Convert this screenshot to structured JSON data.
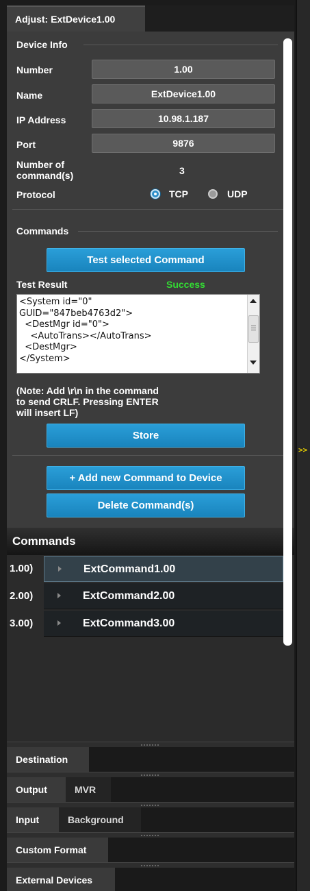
{
  "panel": {
    "title": "Adjust: ExtDevice1.00",
    "expand_arrow": ">>"
  },
  "device_info": {
    "heading": "Device Info",
    "number_label": "Number",
    "number_value": "1.00",
    "name_label": "Name",
    "name_value": "ExtDevice1.00",
    "ip_label": "IP Address",
    "ip_value": "10.98.1.187",
    "port_label": "Port",
    "port_value": "9876",
    "num_commands_label": "Number of\ncommand(s)",
    "num_commands_value": "3",
    "protocol_label": "Protocol",
    "protocol_options": [
      "TCP",
      "UDP"
    ],
    "protocol_selected": "TCP"
  },
  "commands_section": {
    "heading": "Commands",
    "test_button": "Test selected Command",
    "test_result_label": "Test Result",
    "test_result_status": "Success",
    "test_result_color": "#33dd33",
    "result_text": "<System id=\"0\"\nGUID=\"847beb4763d2\">\n  <DestMgr id=\"0\">\n    <AutoTrans></AutoTrans>\n  <DestMgr>\n</System>",
    "note": "(Note: Add \\r\\n in the command\nto send CRLF. Pressing ENTER\nwill insert LF)",
    "store_button": "Store",
    "add_button": "+ Add new Command to Device",
    "delete_button": "Delete Command(s)"
  },
  "commands_list": {
    "heading": "Commands",
    "items": [
      {
        "num": "1.00)",
        "label": "ExtCommand1.00",
        "selected": true
      },
      {
        "num": "2.00)",
        "label": "ExtCommand2.00",
        "selected": false
      },
      {
        "num": "3.00)",
        "label": "ExtCommand3.00",
        "selected": false
      }
    ]
  },
  "bottom_tabs": [
    [
      "Destination"
    ],
    [
      "Output",
      "MVR"
    ],
    [
      "Input",
      "Background"
    ],
    [
      "Custom Format"
    ],
    [
      "External Devices"
    ]
  ]
}
